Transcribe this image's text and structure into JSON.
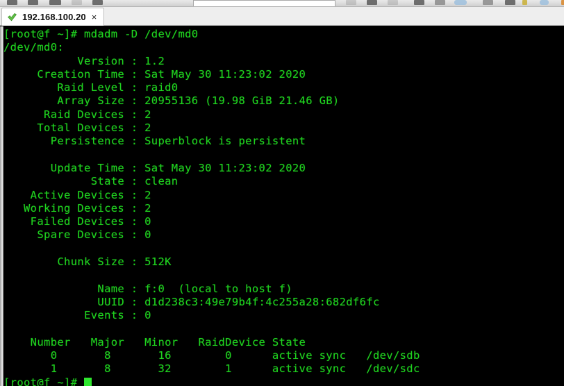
{
  "toolbar": {
    "icons": [
      "floppy-save-icon",
      "save-all-icon",
      "download-icon",
      "cut-icon",
      "copy-icon",
      "undo-icon",
      "folder-icon",
      "link-icon",
      "printer-icon",
      "page-icon",
      "window-icon",
      "document-icon",
      "chart-icon",
      "bulb-icon",
      "globe-icon",
      "terminal-icon"
    ],
    "search_placeholder": ""
  },
  "tabbar": {
    "tabs": [
      {
        "status_icon": "green-check-icon",
        "label": "192.168.100.20",
        "close_label": "×"
      }
    ]
  },
  "terminal": {
    "foreground_color": "#1fd31f",
    "background_color": "#000000",
    "cursor": "block-cursor",
    "lines": [
      "[root@f ~]# mdadm -D /dev/md0",
      "/dev/md0:",
      "           Version : 1.2",
      "     Creation Time : Sat May 30 11:23:02 2020",
      "        Raid Level : raid0",
      "        Array Size : 20955136 (19.98 GiB 21.46 GB)",
      "      Raid Devices : 2",
      "     Total Devices : 2",
      "       Persistence : Superblock is persistent",
      "",
      "       Update Time : Sat May 30 11:23:02 2020",
      "             State : clean",
      "    Active Devices : 2",
      "   Working Devices : 2",
      "    Failed Devices : 0",
      "     Spare Devices : 0",
      "",
      "        Chunk Size : 512K",
      "",
      "              Name : f:0  (local to host f)",
      "              UUID : d1d238c3:49e79b4f:4c255a28:682df6fc",
      "            Events : 0",
      "",
      "    Number   Major   Minor   RaidDevice State",
      "       0       8       16        0      active sync   /dev/sdb",
      "       1       8       32        1      active sync   /dev/sdc"
    ],
    "prompt": "[root@f ~]# ",
    "command": "mdadm -D /dev/md0",
    "device": "/dev/md0",
    "details": {
      "version": "1.2",
      "creation_time": "Sat May 30 11:23:02 2020",
      "raid_level": "raid0",
      "array_size": "20955136 (19.98 GiB 21.46 GB)",
      "raid_devices": "2",
      "total_devices": "2",
      "persistence": "Superblock is persistent",
      "update_time": "Sat May 30 11:23:02 2020",
      "state": "clean",
      "active_devices": "2",
      "working_devices": "2",
      "failed_devices": "0",
      "spare_devices": "0",
      "chunk_size": "512K",
      "name": "f:0  (local to host f)",
      "uuid": "d1d238c3:49e79b4f:4c255a28:682df6fc",
      "events": "0"
    },
    "device_table": {
      "headers": [
        "Number",
        "Major",
        "Minor",
        "RaidDevice",
        "State"
      ],
      "rows": [
        [
          "0",
          "8",
          "16",
          "0",
          "active sync",
          "/dev/sdb"
        ],
        [
          "1",
          "8",
          "32",
          "1",
          "active sync",
          "/dev/sdc"
        ]
      ]
    }
  }
}
